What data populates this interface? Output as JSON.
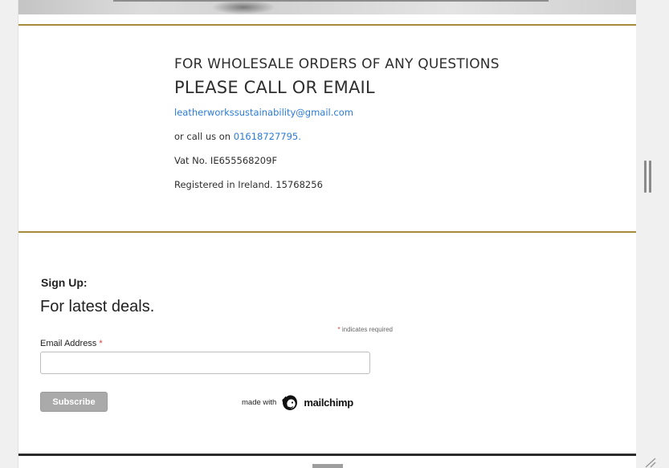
{
  "contact": {
    "heading1": "FOR WHOLESALE ORDERS OF ANY QUESTIONS",
    "heading2": "PLEASE CALL OR EMAIL",
    "email": "leatherworkssustainability@gmail.com",
    "call_prefix": "or call us on ",
    "phone": "01618727795.",
    "vat": "Vat No. IE655568209F",
    "registered": "Registered in Ireland. 15768256"
  },
  "signup": {
    "title": "Sign Up:",
    "subtitle": "For latest deals.",
    "required_star": "*",
    "required_note": " indicates required",
    "email_label": "Email Address ",
    "email_value": "",
    "subscribe_label": "Subscribe",
    "made_with": "made with",
    "brand": "mailchimp"
  },
  "colors": {
    "accent_gold": "#a78b3c",
    "link_blue": "#2b7bd6",
    "required_red": "#e03b3b",
    "button_gray": "#aaaaaa"
  },
  "icons": {
    "brand_logo": "mailchimp-icon",
    "scroll_handle": "drag-handle-icon",
    "resize": "resize-grip-icon"
  }
}
